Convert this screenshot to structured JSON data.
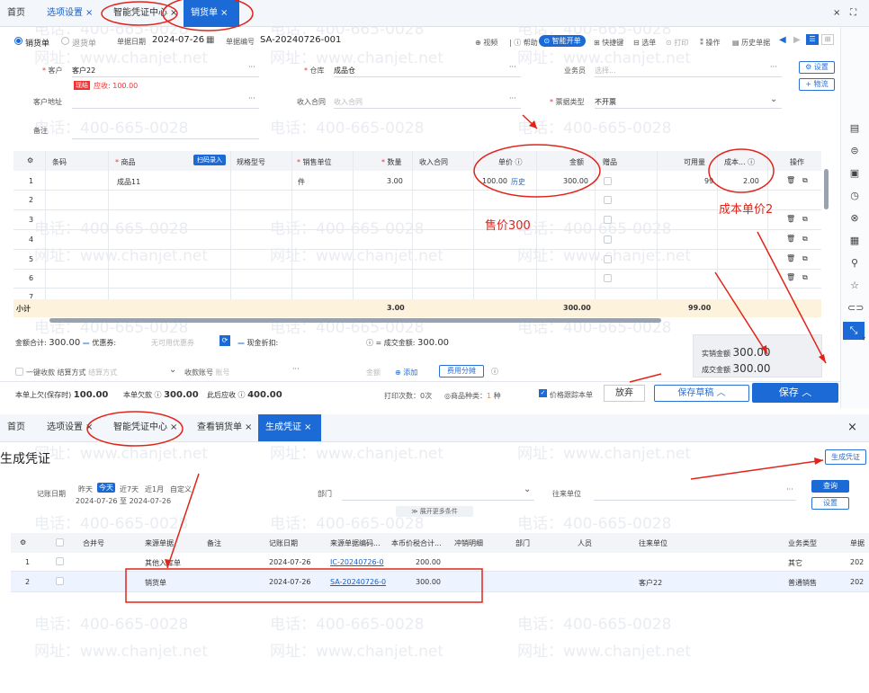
{
  "top": {
    "tabs": [
      {
        "label": "首页"
      },
      {
        "label": "选项设置",
        "close": "×"
      },
      {
        "label": "智能凭证中心",
        "close": "×"
      },
      {
        "label": "销货单",
        "close": "×"
      }
    ],
    "window_close": "×",
    "window_expand": "⛶",
    "radio_sale": "销货单",
    "radio_return": "退货单",
    "date_label": "单据日期",
    "date_value": "2024-07-26",
    "no_label": "单据编号",
    "no_value": "SA-20240726-001",
    "toolbar": {
      "video": "视频",
      "help": "帮助",
      "smart_open": "智能开单",
      "shortcut": "快捷键",
      "select": "选单",
      "print": "打印",
      "ops": "操作",
      "history": "历史单据"
    },
    "customer_label": "客户",
    "customer_value": "客户22",
    "cust_tag": "现结",
    "cust_due_label": "应收:",
    "cust_due": "100.00",
    "warehouse_label": "仓库",
    "warehouse_value": "成品仓",
    "salesman_label": "业务员",
    "salesman_placeholder": "选择...",
    "set_btn": "设置",
    "logistics_btn": "+ 物流",
    "address_label": "客户地址",
    "contract_label": "收入合同",
    "contract_placeholder": "收入合同",
    "invoice_label": "票据类型",
    "invoice_value": "不开票",
    "remark_label": "备注",
    "grid_headers": {
      "gear": "⚙",
      "barcode": "条码",
      "product": "商品",
      "scan": "扫码录入",
      "spec": "规格型号",
      "unit": "销售单位",
      "qty": "数量",
      "contract": "收入合同",
      "price": "单价",
      "amount": "金额",
      "gift": "赠品",
      "avail": "可用量",
      "cost": "成本...",
      "op": "操作"
    },
    "row1": {
      "no": "1",
      "product": "成品11",
      "unit": "件",
      "qty": "3.00",
      "price": "100.00",
      "history": "历史",
      "amount": "300.00",
      "avail": "99",
      "cost": "2.00"
    },
    "row_nums": [
      "2",
      "3",
      "4",
      "5",
      "6",
      "7"
    ],
    "subtotal": {
      "label": "小计",
      "qty": "3.00",
      "amount": "300.00",
      "avail": "99.00"
    },
    "ann_price": "售价300",
    "ann_cost": "成本单价2",
    "sum": {
      "total_label": "金额合计:",
      "total": "300.00",
      "discount_label": "优惠券:",
      "discount_placeholder": "无可用优惠券",
      "cash_discount": "现金折扣:",
      "final_label": "成交金额:",
      "final": "300.00"
    },
    "receipt": {
      "one_click": "一键收款",
      "method_label": "结算方式",
      "method_placeholder": "结算方式",
      "account_label": "收款账号",
      "account_placeholder": "账号",
      "amount_label": "金额",
      "add": "添加",
      "expense": "费用分摊"
    },
    "settle": {
      "actual_label": "实销金额",
      "actual": "300.00",
      "rounded_label": "成交金额",
      "rounded": "300.00"
    },
    "footer": {
      "prev_owe_label": "本单上欠(保存时)",
      "prev_owe": "100.00",
      "this_owe_label": "本单欠款",
      "this_owe": "300.00",
      "after_owe_label": "此后应收",
      "after_owe": "400.00",
      "print_count": "打印次数：0次",
      "types_label": "商品种类：",
      "types": "1",
      "types_unit": "种",
      "price_track": "价格跟踪本单",
      "cancel": "放弃",
      "save_draft": "保存草稿",
      "save": "保存"
    }
  },
  "bottom": {
    "tabs": [
      {
        "label": "首页"
      },
      {
        "label": "选项设置",
        "close": "×"
      },
      {
        "label": "智能凭证中心",
        "close": "×"
      },
      {
        "label": "查看销货单",
        "close": "×"
      },
      {
        "label": "生成凭证",
        "close": "×"
      }
    ],
    "window_close": "×",
    "title": "生成凭证",
    "gen_btn": "生成凭证",
    "date_label": "记账日期",
    "quick": [
      "昨天",
      "今天",
      "近7天",
      "近1月",
      "自定义"
    ],
    "date_range": "2024-07-26 至 2024-07-26",
    "dept_label": "部门",
    "partner_label": "往来单位",
    "query": "查询",
    "settings": "设置",
    "expand": "展开更多条件",
    "headers": [
      "合并号",
      "来源单据",
      "备注",
      "记账日期",
      "来源单据编码...",
      "本币价税合计...",
      "冲销明细",
      "部门",
      "人员",
      "往来单位",
      "业务类型",
      "单据"
    ],
    "rows": [
      {
        "no": "1",
        "src": "其他入库单",
        "date": "2024-07-26",
        "code": "IC-20240726-0",
        "amt": "200.00",
        "partner": "",
        "type": "其它",
        "year": "202"
      },
      {
        "no": "2",
        "src": "销货单",
        "date": "2024-07-26",
        "code": "SA-20240726-0",
        "amt": "300.00",
        "partner": "客户22",
        "type": "普通销售",
        "year": "202"
      }
    ]
  },
  "watermark": {
    "phone": "电话：400-665-0028",
    "site": "网址：www.chanjet.net"
  },
  "colors": {
    "accent": "#1b6ad6",
    "annotation": "#e2231a"
  }
}
